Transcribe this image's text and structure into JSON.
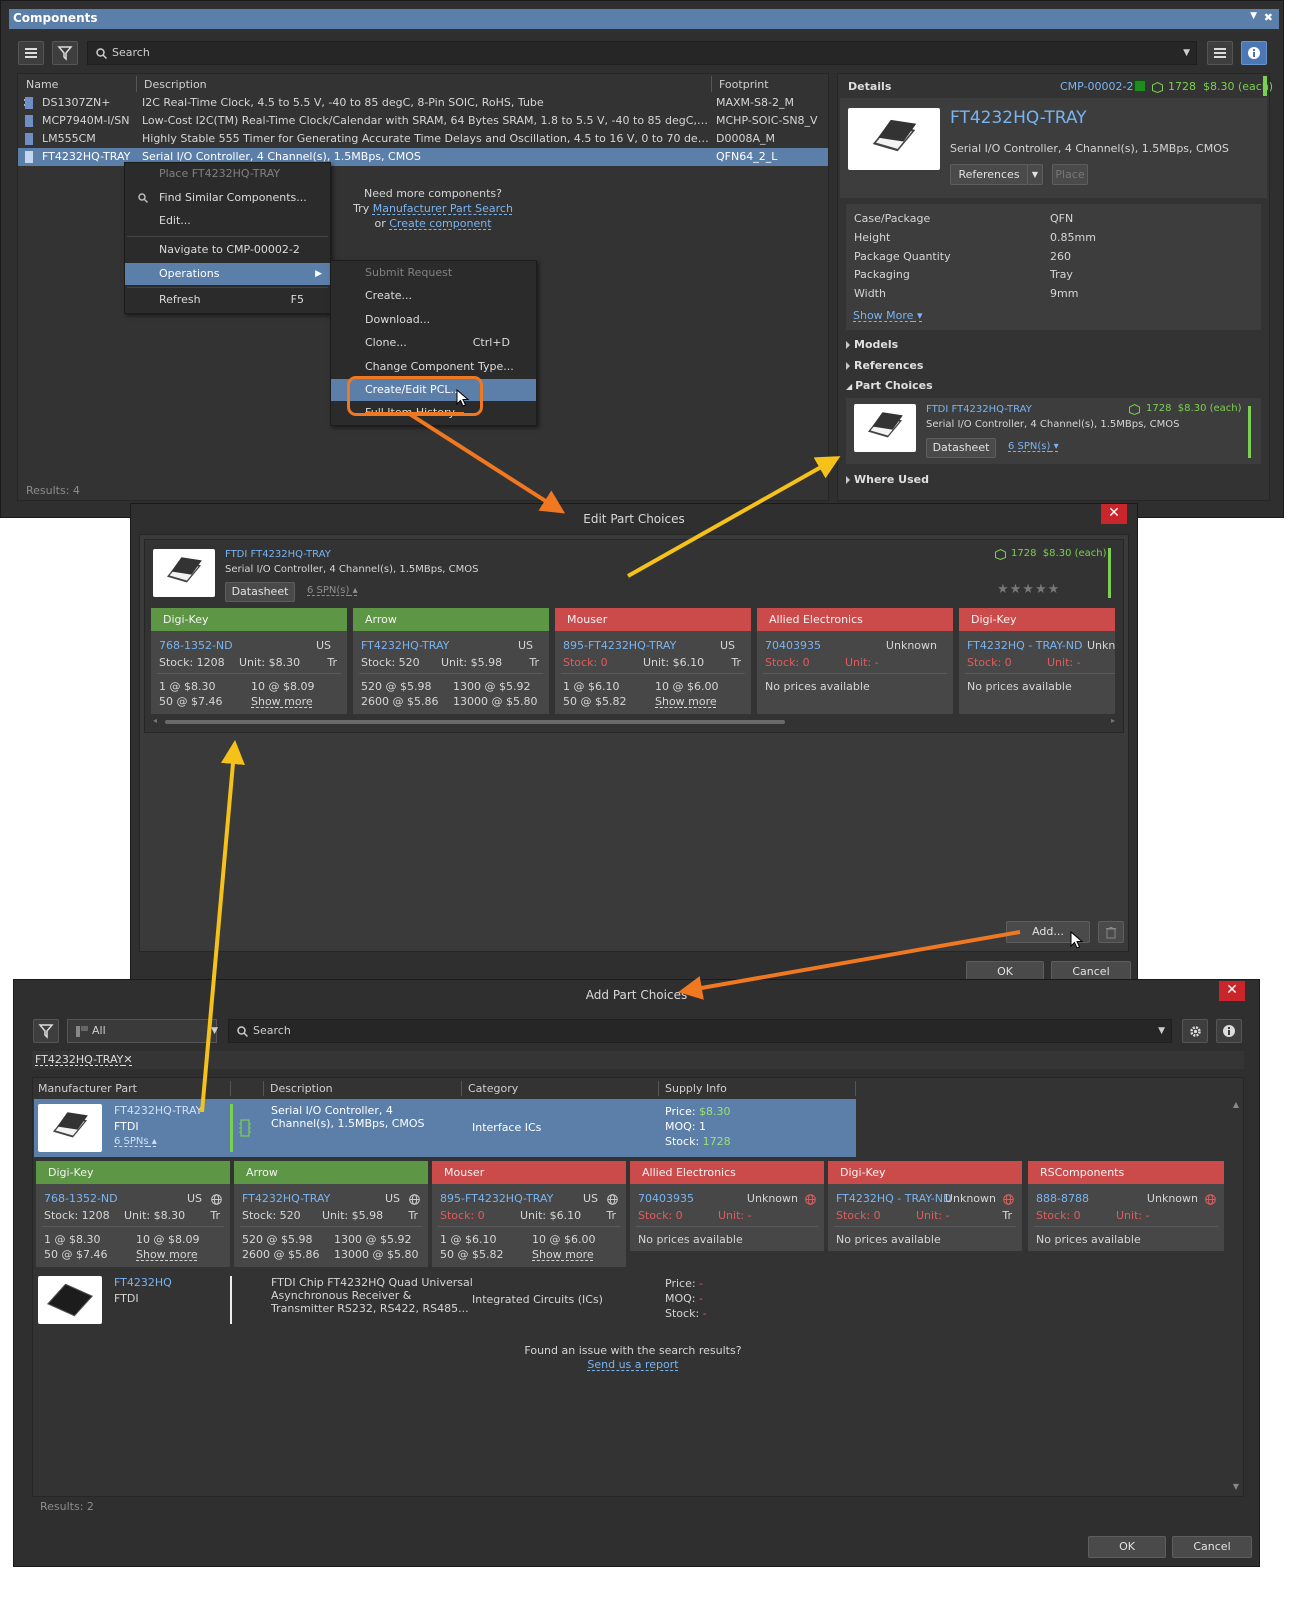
{
  "components": {
    "title": "Components",
    "search_placeholder": "Search",
    "columns": {
      "name": "Name",
      "description": "Description",
      "footprint": "Footprint"
    },
    "rows": [
      {
        "name": "DS1307ZN+",
        "description": "I2C Real-Time Clock, 4.5 to 5.5 V, -40 to 85 degC, 8-Pin SOIC, RoHS, Tube",
        "footprint": "MAXM-S8-2_M"
      },
      {
        "name": "MCP7940M-I/SN",
        "description": "Low-Cost I2C(TM) Real-Time Clock/Calendar with SRAM, 64 Bytes SRAM, 1.8 to 5.5 V, -40 to 85 degC, 8-pin SOIC...",
        "footprint": "MCHP-SOIC-SN8_V"
      },
      {
        "name": "LM555CM",
        "description": "Highly Stable 555 Timer for Generating Accurate Time Delays and Oscillation, 4.5 to 16 V, 0 to 70 degC, 8-Pin SO...",
        "footprint": "D0008A_M"
      },
      {
        "name": "FT4232HQ-TRAY",
        "description": "Serial I/O Controller, 4 Channel(s), 1.5MBps, CMOS",
        "footprint": "QFN64_2_L"
      }
    ],
    "need_more": {
      "line1": "Need more components?",
      "try": "Try",
      "mps_link": "Manufacturer Part Search",
      "or": "or",
      "create_link": "Create component"
    },
    "results": "Results: 4",
    "context_menu": [
      {
        "label": "Place FT4232HQ-TRAY"
      },
      {
        "label": "Find Similar Components..."
      },
      {
        "label": "Edit..."
      },
      {
        "label": "Navigate to CMP-00002-2"
      },
      {
        "label": "Operations"
      },
      {
        "label": "Refresh",
        "shortcut": "F5"
      }
    ],
    "submenu": [
      {
        "label": "Submit Request"
      },
      {
        "label": "Create..."
      },
      {
        "label": "Download..."
      },
      {
        "label": "Clone...",
        "shortcut": "Ctrl+D"
      },
      {
        "label": "Change Component Type..."
      },
      {
        "label": "Create/Edit PCL..."
      },
      {
        "label": "Full Item History..."
      }
    ]
  },
  "details": {
    "header": "Details",
    "cmp_id": "CMP-00002-2",
    "stock_price": "1728  $8.30 (each)",
    "part_name": "FT4232HQ-TRAY",
    "part_desc": "Serial I/O Controller, 4 Channel(s), 1.5MBps, CMOS",
    "references_btn": "References",
    "place_btn": "Place",
    "params": [
      {
        "k": "Case/Package",
        "v": "QFN"
      },
      {
        "k": "Height",
        "v": "0.85mm"
      },
      {
        "k": "Package Quantity",
        "v": "260"
      },
      {
        "k": "Packaging",
        "v": "Tray"
      },
      {
        "k": "Width",
        "v": "9mm"
      }
    ],
    "show_more": "Show More",
    "sections": {
      "models": "Models",
      "references": "References",
      "part_choices": "Part Choices",
      "where_used": "Where Used"
    },
    "pc_card": {
      "mfr": "FTDI FT4232HQ-TRAY",
      "stock_price": "1728  $8.30 (each)",
      "desc": "Serial I/O Controller, 4 Channel(s), 1.5MBps, CMOS",
      "datasheet": "Datasheet",
      "spns": "6 SPN(s)"
    }
  },
  "edit_pc": {
    "title": "Edit Part Choices",
    "mfr": "FTDI FT4232HQ-TRAY",
    "desc": "Serial I/O Controller, 4 Channel(s), 1.5MBps, CMOS",
    "stock_price": "1728  $8.30 (each)",
    "datasheet": "Datasheet",
    "spns": "6 SPN(s)",
    "stars": "★★★★★",
    "suppliers": [
      {
        "name": "Digi-Key",
        "status": "ok",
        "spn": "768-1352-ND",
        "region": "US",
        "stock": "Stock: 1208",
        "unit": "Unit: $8.30",
        "pkg": "Tr",
        "p1": "1 @ $8.30",
        "p2": "10 @ $8.09",
        "p3": "50 @ $7.46",
        "more": "Show more"
      },
      {
        "name": "Arrow",
        "status": "ok",
        "spn": "FT4232HQ-TRAY",
        "region": "US",
        "stock": "Stock: 520",
        "unit": "Unit: $5.98",
        "pkg": "Tr",
        "p1": "520 @ $5.98",
        "p2": "1300 @ $5.92",
        "p3": "2600 @ $5.86",
        "p4": "13000 @ $5.80"
      },
      {
        "name": "Mouser",
        "status": "bad",
        "spn": "895-FT4232HQ-TRAY",
        "region": "US",
        "stock": "Stock: 0",
        "unit": "Unit: $6.10",
        "pkg": "Tr",
        "p1": "1 @ $6.10",
        "p2": "10 @ $6.00",
        "p3": "50 @ $5.82",
        "more": "Show more"
      },
      {
        "name": "Allied Electronics",
        "status": "bad",
        "spn": "70403935",
        "region": "Unknown",
        "stock": "Stock: 0",
        "unit": "Unit: -",
        "none": "No prices available"
      },
      {
        "name": "Digi-Key",
        "status": "bad",
        "spn": "FT4232HQ - TRAY-ND",
        "region": "Unkn",
        "stock": "Stock: 0",
        "unit": "Unit: -",
        "none": "No prices available"
      }
    ],
    "add_btn": "Add...",
    "ok": "OK",
    "cancel": "Cancel"
  },
  "add_pc": {
    "title": "Add Part Choices",
    "filter_value": "All",
    "search_placeholder": "Search",
    "chip_text": "FT4232HQ-TRAY",
    "columns": {
      "mpart": "Manufacturer Part",
      "description": "Description",
      "category": "Category",
      "supply": "Supply Info"
    },
    "result1": {
      "part": "FT4232HQ-TRAY",
      "mfr": "FTDI",
      "spns": "6 SPNs",
      "desc": "Serial I/O Controller, 4 Channel(s), 1.5MBps, CMOS",
      "category": "Interface ICs",
      "price_k": "Price:",
      "price_v": "$8.30",
      "moq_k": "MOQ:",
      "moq_v": "1",
      "stock_k": "Stock:",
      "stock_v": "1728"
    },
    "suppliers": [
      {
        "name": "Digi-Key",
        "status": "ok",
        "spn": "768-1352-ND",
        "region": "US",
        "stock": "Stock: 1208",
        "unit": "Unit: $8.30",
        "pkg": "Tr",
        "p1": "1 @ $8.30",
        "p2": "10 @ $8.09",
        "p3": "50 @ $7.46",
        "more": "Show more"
      },
      {
        "name": "Arrow",
        "status": "ok",
        "spn": "FT4232HQ-TRAY",
        "region": "US",
        "stock": "Stock: 520",
        "unit": "Unit: $5.98",
        "pkg": "Tr",
        "p1": "520 @ $5.98",
        "p2": "1300 @ $5.92",
        "p3": "2600 @ $5.86",
        "p4": "13000 @ $5.80"
      },
      {
        "name": "Mouser",
        "status": "bad",
        "spn": "895-FT4232HQ-TRAY",
        "region": "US",
        "stock": "Stock: 0",
        "unit": "Unit: $6.10",
        "pkg": "Tr",
        "p1": "1 @ $6.10",
        "p2": "10 @ $6.00",
        "p3": "50 @ $5.82",
        "more": "Show more"
      },
      {
        "name": "Allied Electronics",
        "status": "bad",
        "spn": "70403935",
        "region": "Unknown",
        "stock": "Stock: 0",
        "unit": "Unit: -",
        "none": "No prices available"
      },
      {
        "name": "Digi-Key",
        "status": "bad",
        "spn": "FT4232HQ - TRAY-ND",
        "region": "Unknown",
        "stock": "Stock: 0",
        "unit": "Unit: -",
        "pkg": "Tr",
        "none": "No prices available"
      },
      {
        "name": "RSComponents",
        "status": "bad",
        "spn": "888-8788",
        "region": "Unknown",
        "stock": "Stock: 0",
        "unit": "Unit: -",
        "none": "No prices available"
      }
    ],
    "result2": {
      "part": "FT4232HQ",
      "mfr": "FTDI",
      "desc1": "FTDI Chip FT4232HQ Quad Universal",
      "desc2": "Asynchronous Receiver &",
      "desc3": "Transmitter RS232, RS422, RS485...",
      "category": "Integrated Circuits (ICs)",
      "price_k": "Price:",
      "price_v": "-",
      "moq_k": "MOQ:",
      "moq_v": "-",
      "stock_k": "Stock:",
      "stock_v": "-"
    },
    "issue_text": "Found an issue with the search results?",
    "report_link": "Send us a report",
    "results": "Results: 2",
    "ok": "OK",
    "cancel": "Cancel"
  },
  "colors": {
    "accent": "#5b7fa8",
    "ok_header": "#5d9645",
    "bad_header": "#cb4a4a",
    "link": "#79b4f2",
    "callout": "#f07820",
    "arrow_yellow": "#f6c21a"
  }
}
